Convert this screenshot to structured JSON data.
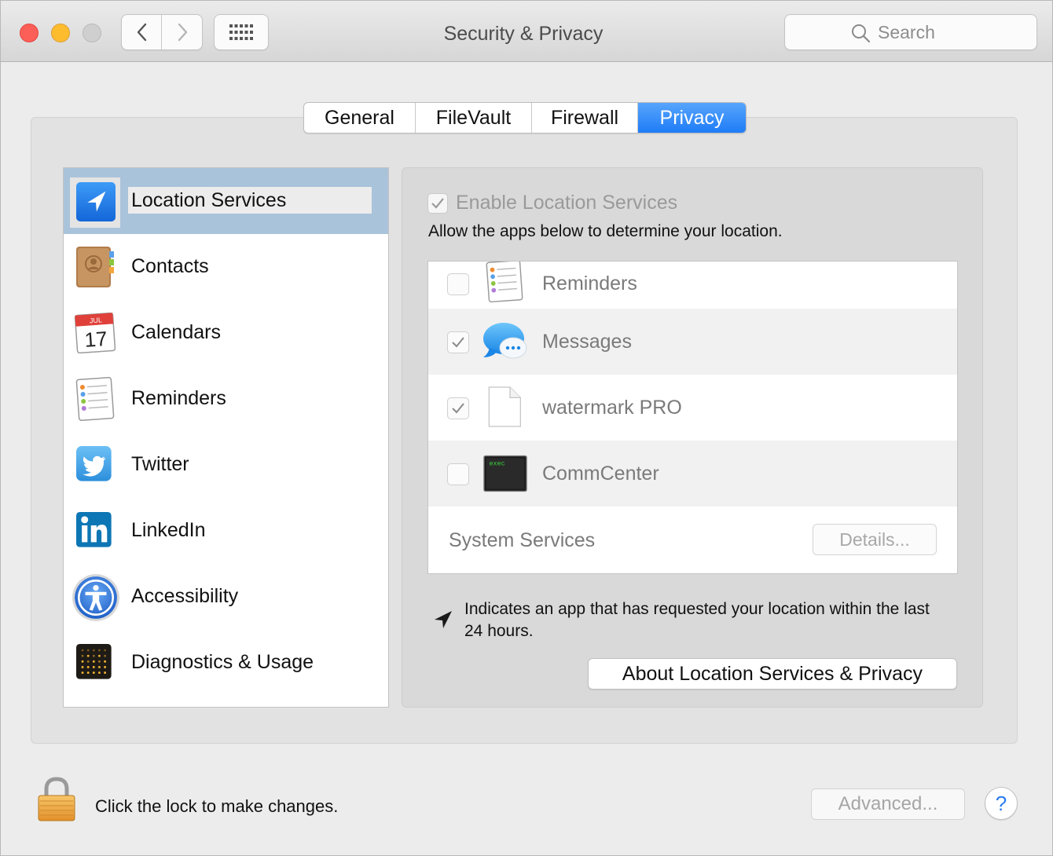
{
  "window": {
    "title": "Security & Privacy"
  },
  "toolbar": {
    "search_placeholder": "Search"
  },
  "tabs": [
    {
      "label": "General",
      "selected": false
    },
    {
      "label": "FileVault",
      "selected": false
    },
    {
      "label": "Firewall",
      "selected": false
    },
    {
      "label": "Privacy",
      "selected": true
    }
  ],
  "sidebar": {
    "items": [
      {
        "label": "Location Services",
        "icon": "location-arrow-icon",
        "selected": true
      },
      {
        "label": "Contacts",
        "icon": "contacts-book-icon"
      },
      {
        "label": "Calendars",
        "icon": "calendar-icon",
        "icon_month": "JUL",
        "icon_day": "17"
      },
      {
        "label": "Reminders",
        "icon": "reminders-list-icon"
      },
      {
        "label": "Twitter",
        "icon": "twitter-bird-icon"
      },
      {
        "label": "LinkedIn",
        "icon": "linkedin-icon"
      },
      {
        "label": "Accessibility",
        "icon": "accessibility-person-icon"
      },
      {
        "label": "Diagnostics & Usage",
        "icon": "diagnostics-dots-icon"
      }
    ]
  },
  "location": {
    "enable_label": "Enable Location Services",
    "enable_checked": true,
    "description": "Allow the apps below to determine your location.",
    "apps": [
      {
        "label": "Reminders",
        "checked": false,
        "icon": "reminders-list-icon"
      },
      {
        "label": "Messages",
        "checked": true,
        "icon": "messages-bubble-icon"
      },
      {
        "label": "watermark PRO",
        "checked": true,
        "icon": "blank-document-icon"
      },
      {
        "label": "CommCenter",
        "checked": false,
        "icon": "terminal-exec-icon",
        "icon_text": "exec"
      }
    ],
    "system_services_label": "System Services",
    "details_label": "Details...",
    "legend_text": "Indicates an app that has requested your location within the last 24 hours.",
    "about_label": "About Location Services & Privacy"
  },
  "footer": {
    "lock_text": "Click the lock to make changes.",
    "advanced_label": "Advanced...",
    "help_label": "?"
  },
  "colors": {
    "accent": "#1f7cf7",
    "selection": "#a9c3da",
    "close": "#fc5f57",
    "minimize": "#fdbc2e"
  }
}
